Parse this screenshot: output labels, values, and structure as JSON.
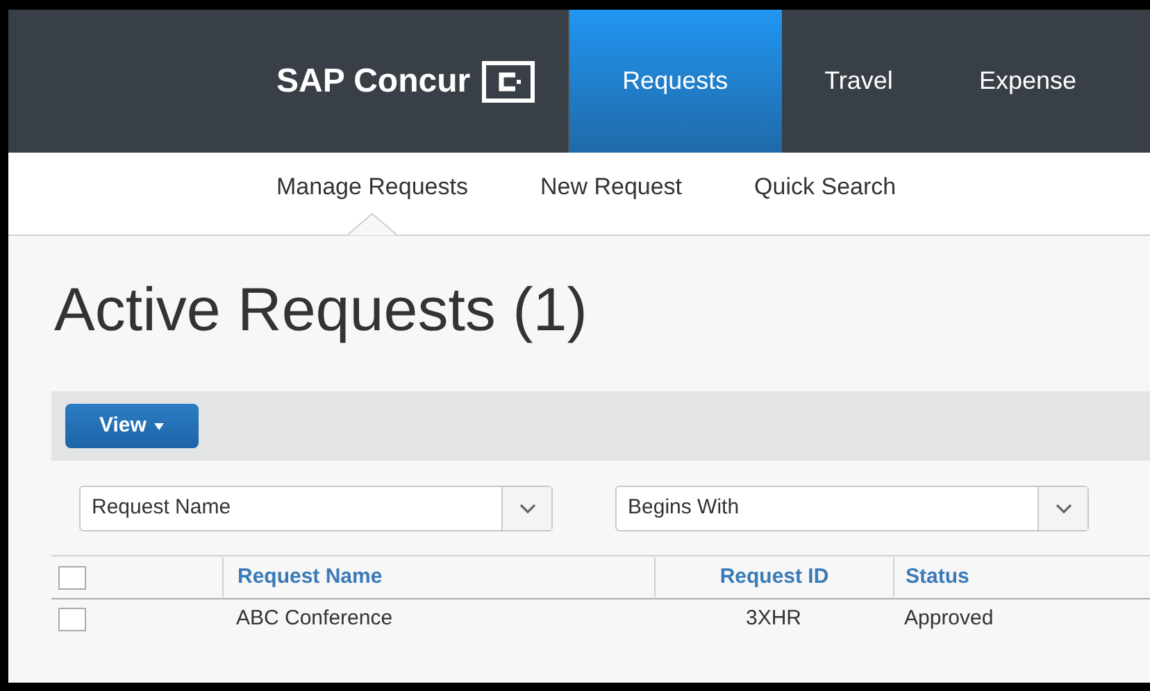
{
  "header": {
    "brand": "SAP Concur",
    "tabs": [
      {
        "label": "Requests",
        "selected": true
      },
      {
        "label": "Travel",
        "selected": false
      },
      {
        "label": "Expense",
        "selected": false
      }
    ]
  },
  "subnav": [
    {
      "label": "Manage Requests",
      "selected": true
    },
    {
      "label": "New Request",
      "selected": false
    },
    {
      "label": "Quick Search",
      "selected": false
    }
  ],
  "title": "Active Requests (1)",
  "toolbar": {
    "view_button": "View"
  },
  "filters": [
    {
      "value": "Request Name"
    },
    {
      "value": "Begins With"
    }
  ],
  "table": {
    "select_all_checked": false,
    "columns": [
      "Request Name",
      "Request ID",
      "Status"
    ],
    "rows": [
      {
        "checked": false,
        "cells": [
          "ABC Conference",
          "3XHR",
          "Approved"
        ]
      }
    ]
  }
}
